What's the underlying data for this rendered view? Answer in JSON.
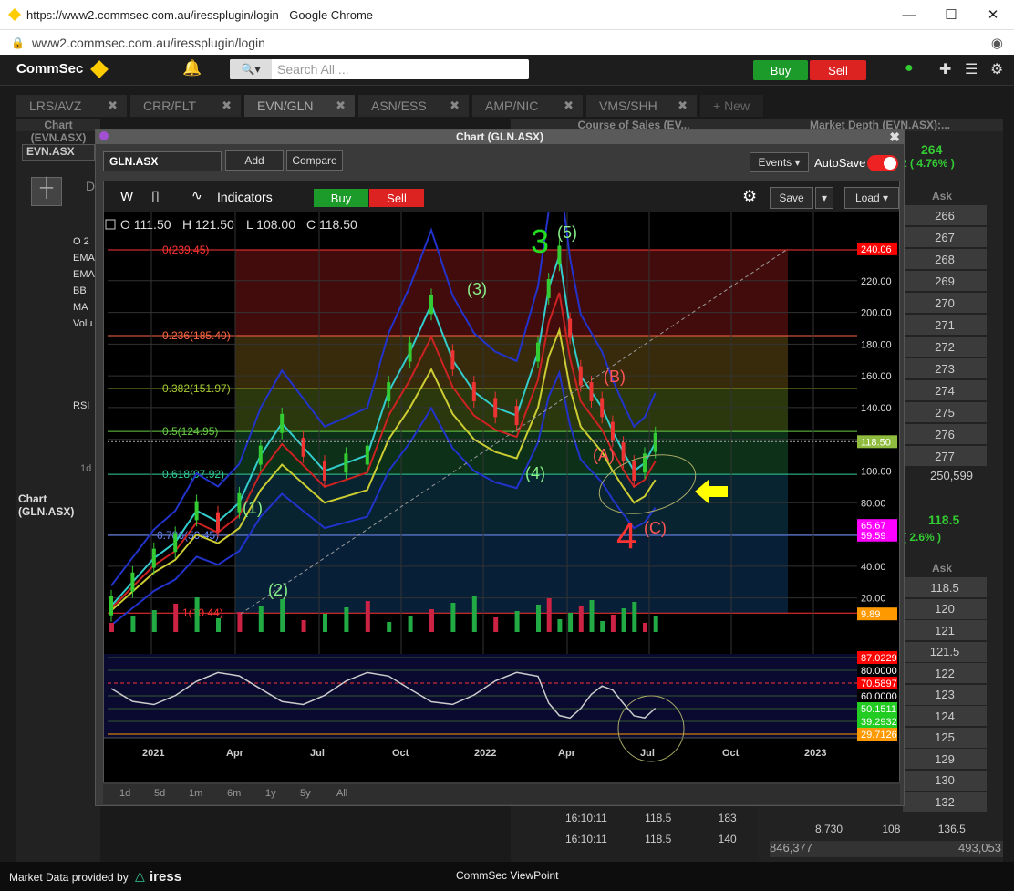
{
  "browser": {
    "title": "https://www2.commsec.com.au/iressplugin/login - Google Chrome",
    "url": "www2.commsec.com.au/iressplugin/login"
  },
  "nav": {
    "brand": "CommSec",
    "search_placeholder": "Search All ...",
    "buy": "Buy",
    "sell": "Sell"
  },
  "tabs": [
    "LRS/AVZ",
    "CRR/FLT",
    "EVN/GLN",
    "ASN/ESS",
    "AMP/NIC",
    "VMS/SHH",
    "+ New"
  ],
  "background": {
    "left_panel_title": "Chart (EVN.ASX)",
    "left_symbol": "EVN.ASX",
    "left_partial_label": "D",
    "left_indicators": [
      "O 2",
      "EMA",
      "EMA",
      "BB",
      "MA",
      "Volu",
      "RSI"
    ],
    "left_bottom_title": "Chart (GLN.ASX)",
    "left_range": "1d",
    "mid_title": "Course of Sales (EV...",
    "mid_rows": [
      {
        "time": "16:10:11",
        "price": "118.5",
        "vol": "183"
      },
      {
        "time": "16:10:11",
        "price": "118.5",
        "vol": "140"
      }
    ],
    "right_title": "Market Depth (EVN.ASX):...",
    "right_price": "264",
    "right_change": "2 ( 4.76% )",
    "right_ask_header": "Ask",
    "right_ask_values": [
      "266",
      "267",
      "268",
      "269",
      "270",
      "271",
      "272",
      "273",
      "274",
      "275",
      "276",
      "277"
    ],
    "right_total": "250,599",
    "right2_price": "118.5",
    "right2_change": "( 2.6% )",
    "right2_ask_header": "Ask",
    "right2_ask_values": [
      "118.5",
      "120",
      "121",
      "121.5",
      "122",
      "123",
      "124",
      "125",
      "129",
      "130",
      "132"
    ],
    "right2_row": [
      "8.730",
      "108",
      "136.5"
    ],
    "right2_totals": [
      "846,377",
      "493,053"
    ]
  },
  "chart_window": {
    "title": "Chart (GLN.ASX)",
    "symbol": "GLN.ASX",
    "add": "Add",
    "compare": "Compare",
    "events": "Events",
    "autosave": "AutoSave",
    "toolbar": {
      "interval": "W",
      "indicators": "Indicators",
      "buy": "Buy",
      "sell": "Sell",
      "save": "Save",
      "load": "Load"
    },
    "ohlc": {
      "o": "O 111.50",
      "h": "H 121.50",
      "l": "L 108.00",
      "c": "C 118.50"
    },
    "ranges": [
      "1d",
      "5d",
      "1m",
      "6m",
      "1y",
      "5y",
      "All"
    ]
  },
  "chart_data": {
    "type": "line",
    "y_axis_ticks": [
      "220.00",
      "200.00",
      "180.00",
      "160.00",
      "140.00",
      "120.00",
      "100.00",
      "80.00",
      "60.00",
      "40.00",
      "20.00"
    ],
    "x_axis_ticks": [
      "2021",
      "Apr",
      "Jul",
      "Oct",
      "2022",
      "Apr",
      "Jul",
      "Oct",
      "2023"
    ],
    "ylim": [
      0,
      250
    ],
    "fib_levels": [
      {
        "label": "0(239.45)",
        "value": 239.45
      },
      {
        "label": "0.236(185.40)",
        "value": 185.4
      },
      {
        "label": "0.382(151.97)",
        "value": 151.97
      },
      {
        "label": "0.5(124.95)",
        "value": 124.95
      },
      {
        "label": "0.618(97.92)",
        "value": 97.92
      },
      {
        "label": "0.786(59.45)",
        "value": 59.45
      },
      {
        "label": "1(10.44)",
        "value": 10.44
      }
    ],
    "price_labels": [
      {
        "text": "240.06",
        "value": 240.06,
        "color": "#ff0000"
      },
      {
        "text": "118.50",
        "value": 118.5,
        "color": "#8fbc3f"
      },
      {
        "text": "65.67",
        "value": 65.67,
        "color": "#ff00ff"
      },
      {
        "text": "59.59",
        "value": 59.59,
        "color": "#ff00ff"
      },
      {
        "text": "9.89",
        "value": 9.89,
        "color": "#ff9900"
      }
    ],
    "wave_labels": [
      {
        "text": "3",
        "color": "#22dd22"
      },
      {
        "text": "(5)",
        "color": "#88ee88"
      },
      {
        "text": "(3)",
        "color": "#88ee88"
      },
      {
        "text": "(1)",
        "color": "#88ee88"
      },
      {
        "text": "(2)",
        "color": "#88ee88"
      },
      {
        "text": "(4)",
        "color": "#88ee88"
      },
      {
        "text": "(B)",
        "color": "#ff5555"
      },
      {
        "text": "(A)",
        "color": "#ff5555"
      },
      {
        "text": "(C)",
        "color": "#ff5555"
      },
      {
        "text": "4",
        "color": "#ff3333"
      }
    ],
    "series": [
      {
        "x": [
          0,
          4,
          8,
          12,
          16,
          20,
          24,
          28,
          32,
          36,
          40,
          44,
          48,
          52,
          56,
          60,
          64,
          68,
          72,
          76,
          80,
          82,
          84,
          86,
          88,
          90,
          92,
          94,
          96,
          98,
          100,
          102
        ],
        "values": [
          15,
          30,
          45,
          55,
          75,
          68,
          80,
          110,
          130,
          115,
          100,
          105,
          110,
          150,
          175,
          205,
          170,
          150,
          140,
          135,
          175,
          215,
          236,
          190,
          160,
          150,
          140,
          125,
          112,
          100,
          105,
          118
        ]
      }
    ],
    "rsi_labels": [
      {
        "text": "87.0229",
        "color": "#ff0000"
      },
      {
        "text": "80.0000",
        "color": "#ffffff"
      },
      {
        "text": "70.5897",
        "color": "#ff0000"
      },
      {
        "text": "60.0000",
        "color": "#ffffff"
      },
      {
        "text": "50.1511",
        "color": "#22cc22"
      },
      {
        "text": "39.2932",
        "color": "#22cc22"
      },
      {
        "text": "29.7126",
        "color": "#ff9900"
      }
    ]
  },
  "footer": {
    "market_data": "Market Data provided by",
    "brand": "iress",
    "app": "CommSec ViewPoint"
  }
}
